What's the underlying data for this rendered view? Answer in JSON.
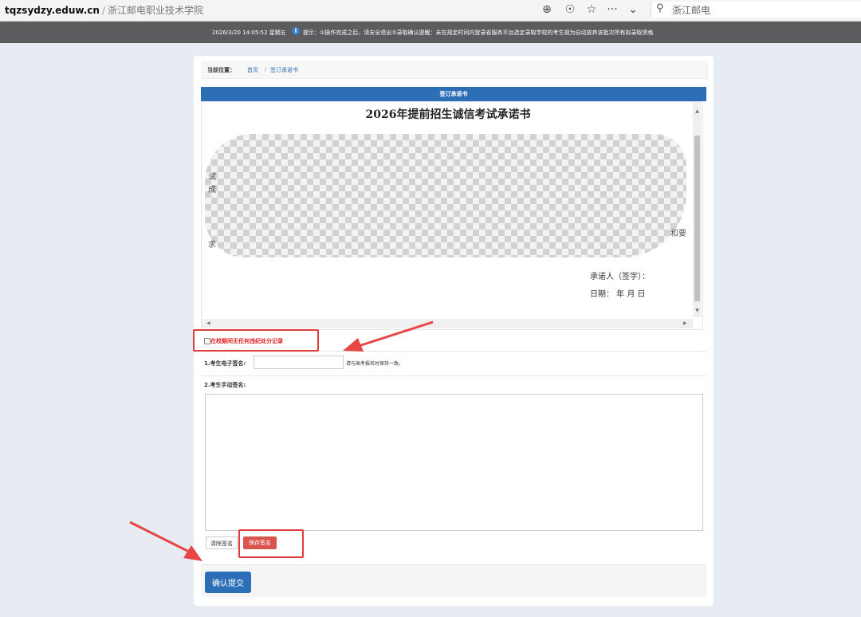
{
  "browser": {
    "domain": "tqzsydzy.eduw.cn",
    "separator": "/",
    "title": "浙江邮电职业技术学院",
    "search_text": "浙江邮电",
    "icons": [
      "zoom-icon",
      "extension-icon",
      "star-icon",
      "more-icon",
      "chevron-down-icon",
      "search-icon"
    ]
  },
  "notice": {
    "datetime": "2026/3/20 14:05:52 星期五",
    "message": "提示：①操作完成之后，请安全退出②录取确认提醒：未在规定时间内登录省服务平台选定录取学校的考生视为自动放弃该批次所有拟录取资格"
  },
  "breadcrumb": {
    "label": "当前位置：",
    "home": "首页",
    "sep": "/",
    "current": "签订承诺书"
  },
  "panel": {
    "header": "签订承诺书",
    "doc_title": "2026年提前招生诚信考试承诺书",
    "visible_fragments": [
      "试",
      "成",
      "求",
      "和要"
    ],
    "signer_label": "承诺人（签字）：",
    "date_label": "日期：  年  月  日"
  },
  "form": {
    "checkbox_label": "在校期间无任何违纪处分记录",
    "esign_label": "1.考生电子签名:",
    "esign_value": "",
    "esign_hint": "请与高考报名时保持一致。",
    "handsign_label": "2.考生手动签名:",
    "clear_button": "清除签名",
    "save_button": "保存签名",
    "submit_button": "确认提交"
  },
  "colors": {
    "primary": "#2d6fb7",
    "danger": "#d9534f",
    "highlight": "#e03c3c",
    "notice_bg": "#5a5c5e"
  }
}
